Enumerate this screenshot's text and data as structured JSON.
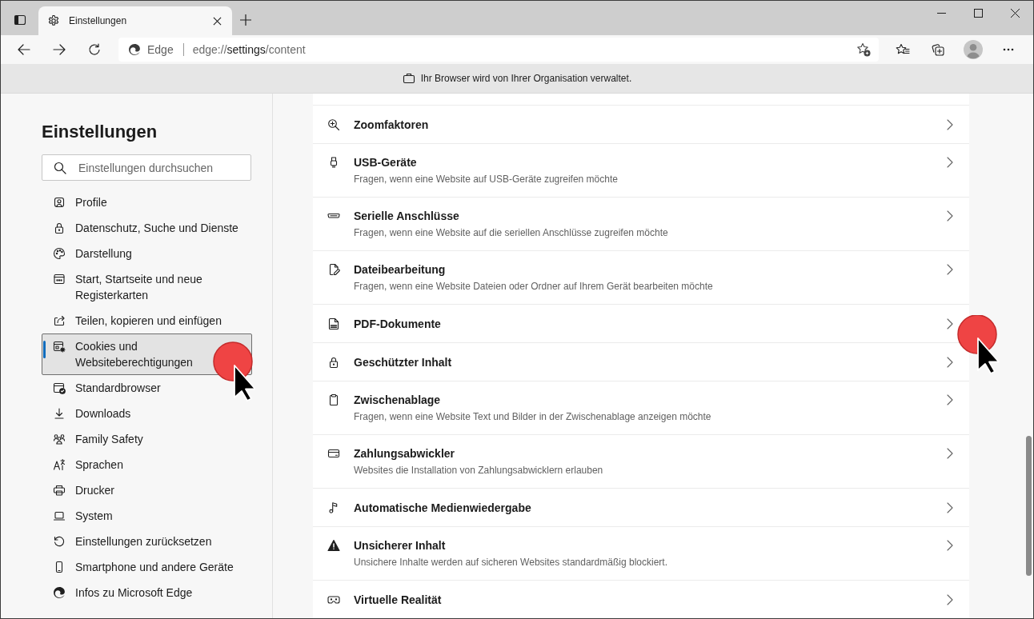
{
  "browser": {
    "tabs": [
      {
        "title": "Einstellungen",
        "selected": true
      }
    ],
    "address_bar": {
      "site_label": "Edge",
      "url": "edge://settings/content"
    }
  },
  "managed_banner": {
    "text": "Ihr Browser wird von Ihrer Organisation verwaltet."
  },
  "sidebar": {
    "title": "Einstellungen",
    "search": {
      "placeholder": "Einstellungen durchsuchen"
    },
    "items": [
      {
        "label": "Profile",
        "selected": false
      },
      {
        "label": "Datenschutz, Suche und Dienste",
        "selected": false
      },
      {
        "label": "Darstellung",
        "selected": false
      },
      {
        "label": "Start, Startseite und neue Registerkarten",
        "selected": false
      },
      {
        "label": "Teilen, kopieren und einfügen",
        "selected": false
      },
      {
        "label": "Cookies und Websiteberechtigungen",
        "selected": true
      },
      {
        "label": "Standardbrowser",
        "selected": false
      },
      {
        "label": "Downloads",
        "selected": false
      },
      {
        "label": "Family Safety",
        "selected": false
      },
      {
        "label": "Sprachen",
        "selected": false
      },
      {
        "label": "Drucker",
        "selected": false
      },
      {
        "label": "System",
        "selected": false
      },
      {
        "label": "Einstellungen zurücksetzen",
        "selected": false
      },
      {
        "label": "Smartphone und andere Geräte",
        "selected": false
      },
      {
        "label": "Infos zu Microsoft Edge",
        "selected": false
      }
    ]
  },
  "content": {
    "rows": [
      {
        "title": "Zoomfaktoren"
      },
      {
        "title": "USB-Geräte",
        "description": "Fragen, wenn eine Website auf USB-Geräte zugreifen möchte"
      },
      {
        "title": "Serielle Anschlüsse",
        "description": "Fragen, wenn eine Website auf die seriellen Anschlüsse zugreifen möchte"
      },
      {
        "title": "Dateibearbeitung",
        "description": "Fragen, wenn eine Website Dateien oder Ordner auf Ihrem Gerät bearbeiten möchte"
      },
      {
        "title": "PDF-Dokumente"
      },
      {
        "title": "Geschützter Inhalt"
      },
      {
        "title": "Zwischenablage",
        "description": "Fragen, wenn eine Website Text und Bilder in der Zwischenablage anzeigen möchte"
      },
      {
        "title": "Zahlungsabwickler",
        "description": "Websites die Installation von Zahlungsabwicklern erlauben"
      },
      {
        "title": "Automatische Medienwiedergabe"
      },
      {
        "title": "Unsicherer Inhalt",
        "description": "Unsichere Inhalte werden auf sicheren Websites standardmäßig blockiert."
      },
      {
        "title": "Virtuelle Realität"
      }
    ]
  }
}
